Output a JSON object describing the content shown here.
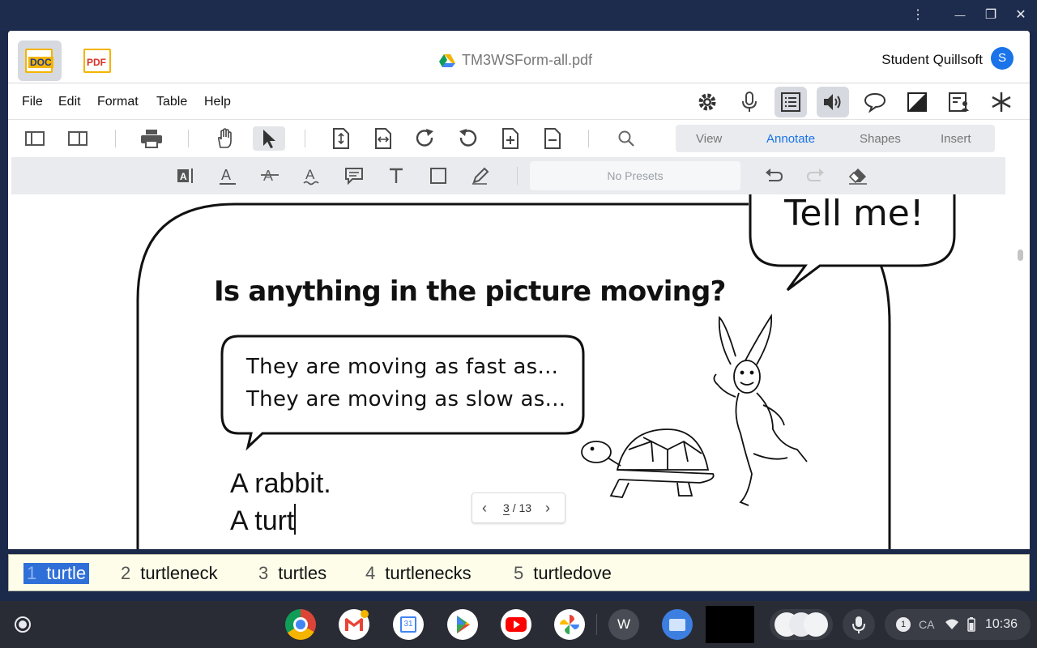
{
  "window": {
    "controls": {
      "more": "⋮",
      "minimize": "—",
      "restore": "❐",
      "close": "✕"
    }
  },
  "header": {
    "doc_label": "DOC",
    "pdf_label": "PDF",
    "filename": "TM3WSForm-all.pdf",
    "user_name": "Student Quillsoft",
    "avatar_initial": "S"
  },
  "menu": {
    "file": "File",
    "edit": "Edit",
    "format": "Format",
    "table": "Table",
    "help": "Help"
  },
  "right_tools": [
    "gear-icon",
    "microphone-icon",
    "reading-list-icon",
    "speaker-icon",
    "speech-bubble-icon",
    "contrast-icon",
    "user-card-icon",
    "asterisk-icon"
  ],
  "tabs": {
    "view": "View",
    "annotate": "Annotate",
    "shapes": "Shapes",
    "insert": "Insert",
    "active": "Annotate"
  },
  "annotate_toolbar": {
    "presets_label": "No Presets"
  },
  "document": {
    "bubble_top": "Tell me!",
    "question": "Is anything in the picture moving?",
    "bubble_line1": "They are moving as fast as...",
    "bubble_line2": "They are moving as slow as...",
    "answer_line1": "A rabbit.",
    "answer_line2": "A turt"
  },
  "page_nav": {
    "current": "3",
    "separator": "/",
    "total": "13"
  },
  "suggestions": [
    {
      "num": "1",
      "word": "turtle",
      "selected": true
    },
    {
      "num": "2",
      "word": "turtleneck",
      "selected": false
    },
    {
      "num": "3",
      "word": "turtles",
      "selected": false
    },
    {
      "num": "4",
      "word": "turtlenecks",
      "selected": false
    },
    {
      "num": "5",
      "word": "turtledove",
      "selected": false
    }
  ],
  "shelf": {
    "apps": [
      "chrome-icon",
      "gmail-icon",
      "calendar-icon",
      "play-store-icon",
      "youtube-icon",
      "photos-icon",
      "w-app-icon",
      "files-icon"
    ],
    "calendar_day": "31",
    "w_app_letter": "W",
    "notification_count": "1",
    "keyboard_locale": "CA",
    "time": "10:36"
  },
  "colors": {
    "accent": "#1a73e8",
    "titlebar": "#1d2b4d",
    "suggest_bg": "#fdfde9",
    "suggest_sel": "#2f6fd8",
    "shelf": "#2a2c35"
  }
}
